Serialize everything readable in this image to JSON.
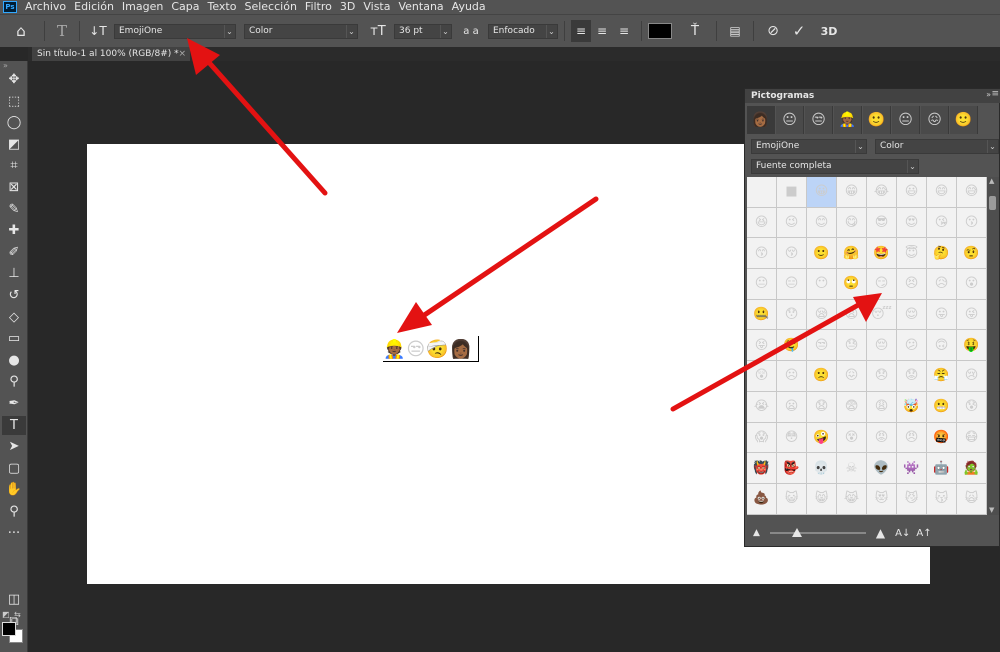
{
  "menubar": {
    "logo": "Ps",
    "items": [
      "Archivo",
      "Edición",
      "Imagen",
      "Capa",
      "Texto",
      "Selección",
      "Filtro",
      "3D",
      "Vista",
      "Ventana",
      "Ayuda"
    ]
  },
  "options": {
    "font_family": "EmojiOne",
    "font_style": "Color",
    "font_size": "36 pt",
    "aa_icon_label": "a a",
    "antialias": "Enfocado",
    "text_color": "#000000",
    "three_d_label": "3D"
  },
  "document": {
    "tab_title": "Sin título-1 al 100% (RGB/8#) *",
    "close": "×"
  },
  "canvas": {
    "text_glyphs": [
      "👷🏾",
      "😒",
      "🤕",
      "👩🏾"
    ]
  },
  "toolbar": {
    "grip": "»",
    "tools": [
      {
        "name": "move",
        "glyph": "✥"
      },
      {
        "name": "marquee",
        "glyph": "⬚"
      },
      {
        "name": "lasso",
        "glyph": "◯"
      },
      {
        "name": "object-select",
        "glyph": "◩"
      },
      {
        "name": "crop",
        "glyph": "⌗"
      },
      {
        "name": "frame",
        "glyph": "⊠"
      },
      {
        "name": "eyedropper",
        "glyph": "✎"
      },
      {
        "name": "healing",
        "glyph": "✚"
      },
      {
        "name": "brush",
        "glyph": "✐"
      },
      {
        "name": "stamp",
        "glyph": "⊥"
      },
      {
        "name": "history-brush",
        "glyph": "↺"
      },
      {
        "name": "eraser",
        "glyph": "◇"
      },
      {
        "name": "gradient",
        "glyph": "▭"
      },
      {
        "name": "blur",
        "glyph": "●"
      },
      {
        "name": "dodge",
        "glyph": "⚲"
      },
      {
        "name": "pen",
        "glyph": "✒"
      },
      {
        "name": "type",
        "glyph": "T"
      },
      {
        "name": "path-select",
        "glyph": "➤"
      },
      {
        "name": "shape",
        "glyph": "▢"
      },
      {
        "name": "hand",
        "glyph": "✋"
      },
      {
        "name": "zoom",
        "glyph": "⚲"
      },
      {
        "name": "more",
        "glyph": "···"
      }
    ],
    "bottom_tools": [
      {
        "name": "quick-mask",
        "glyph": "◫"
      },
      {
        "name": "screen-mode",
        "glyph": "⧉"
      }
    ],
    "fg_color": "#000000",
    "bg_color": "#ffffff"
  },
  "panel": {
    "title": "Pictogramas",
    "collapse": "»",
    "menu": "≡",
    "recent": [
      "👩🏾",
      "😐",
      "😒",
      "👷🏾",
      "🙂",
      "😐",
      "😖",
      "🙂"
    ],
    "font_family": "EmojiOne",
    "font_style": "Color",
    "subset": "Fuente completa",
    "glyphs": [
      "",
      "■",
      "😀",
      "😁",
      "😂",
      "😃",
      "😄",
      "😅",
      "😆",
      "😉",
      "😊",
      "😋",
      "😎",
      "😍",
      "😘",
      "😗",
      "😙",
      "😚",
      "🙂",
      "🤗",
      "🤩",
      "😇",
      "🤔",
      "🤨",
      "😐",
      "😑",
      "😶",
      "🙄",
      "😏",
      "😣",
      "😥",
      "😮",
      "🤐",
      "😯",
      "😪",
      "😫",
      "😴",
      "😌",
      "😛",
      "😜",
      "😝",
      "🤤",
      "😒",
      "😓",
      "😔",
      "😕",
      "🙃",
      "🤑",
      "😲",
      "☹",
      "🙁",
      "😖",
      "😞",
      "😟",
      "😤",
      "😢",
      "😭",
      "😦",
      "😧",
      "😨",
      "😩",
      "🤯",
      "😬",
      "😰",
      "😱",
      "😳",
      "🤪",
      "😵",
      "😡",
      "😠",
      "🤬",
      "😷",
      "👹",
      "👺",
      "💀",
      "☠",
      "👽",
      "👾",
      "🤖",
      "🧟",
      "💩",
      "😺",
      "😸",
      "😹",
      "😻",
      "😼",
      "😽",
      "🙀",
      "😿",
      "😾",
      "🙈",
      "🙉",
      "🙊",
      "👶",
      "👦",
      "👧"
    ],
    "size_small": "▲",
    "size_large": "▲",
    "font_dec": "A↓",
    "font_inc": "A↑",
    "scroll_up": "▲",
    "scroll_down": "▼"
  },
  "colors": {
    "ui_dark": "#535353",
    "workspace": "#282828",
    "arrow": "#e31212"
  }
}
